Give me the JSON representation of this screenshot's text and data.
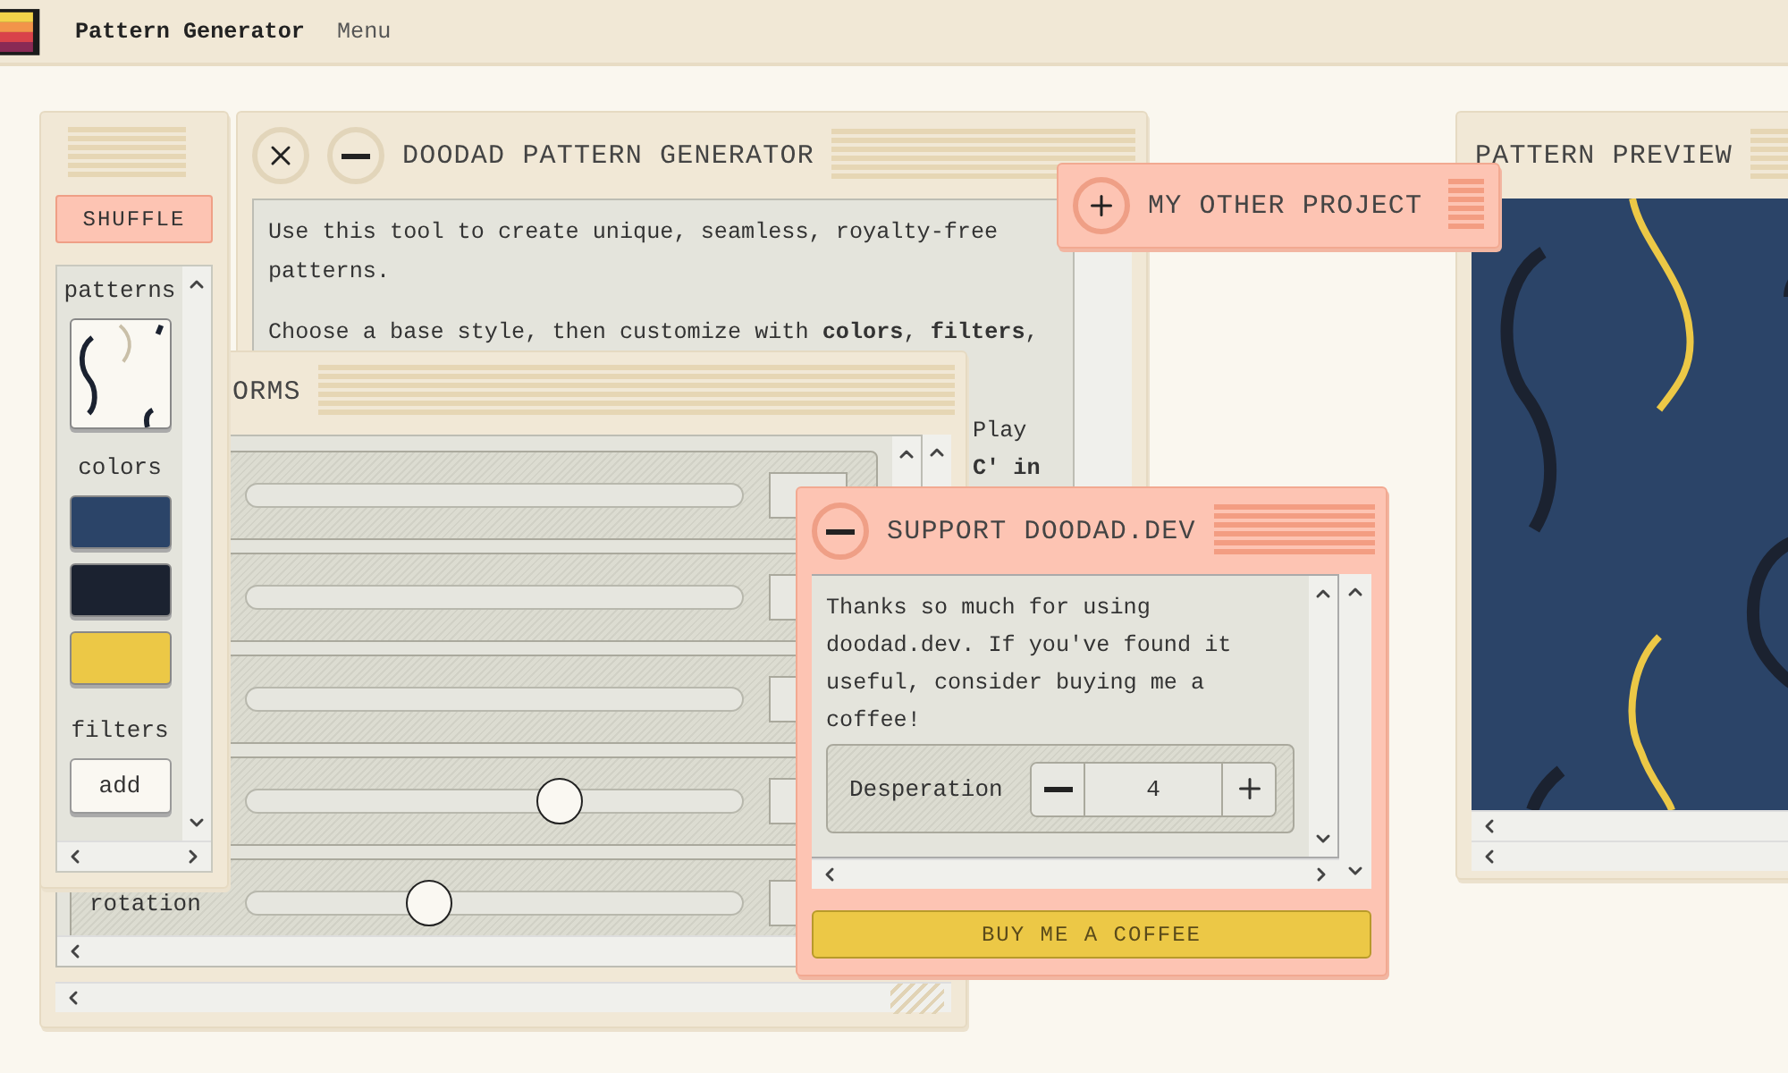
{
  "app_bar": {
    "title": "Pattern Generator",
    "menu": "Menu"
  },
  "generator_window": {
    "title": "DOODAD PATTERN GENERATOR",
    "paragraphs": [
      "Use this tool to create unique, seamless, royalty-free patterns.",
      "Choose a base style, then customize with **colors**, **filters**,"
    ],
    "fragments": [
      "Play",
      "**C' in**"
    ]
  },
  "preview_window": {
    "title": "PATTERN PREVIEW"
  },
  "transforms_window": {
    "title": "ORMS",
    "sliders": [
      {
        "kind": "slider"
      },
      {
        "kind": "slider"
      },
      {
        "kind": "slider"
      },
      {
        "kind": "slider",
        "level": 0.63
      },
      {
        "kind": "slider",
        "label": "rotation",
        "level": 0.37
      }
    ]
  },
  "sidebar": {
    "shuffle": "SHUFFLE",
    "patterns_label": "patterns",
    "colors_label": "colors",
    "colors": [
      {
        "color": "#2b4468"
      },
      {
        "color": "#1b2230"
      },
      {
        "color": "#ecc846"
      }
    ],
    "filters_label": "filters",
    "add_button": "add"
  },
  "other_project_window": {
    "title": "MY OTHER PROJECT"
  },
  "support_window": {
    "title": "SUPPORT DOODAD.DEV",
    "message": "Thanks so much for using doodad.dev. If you've found it useful, consider buying me a coffee!",
    "stepper": {
      "label": "Desperation",
      "value": "4"
    },
    "button": "BUY ME A COFFEE"
  }
}
